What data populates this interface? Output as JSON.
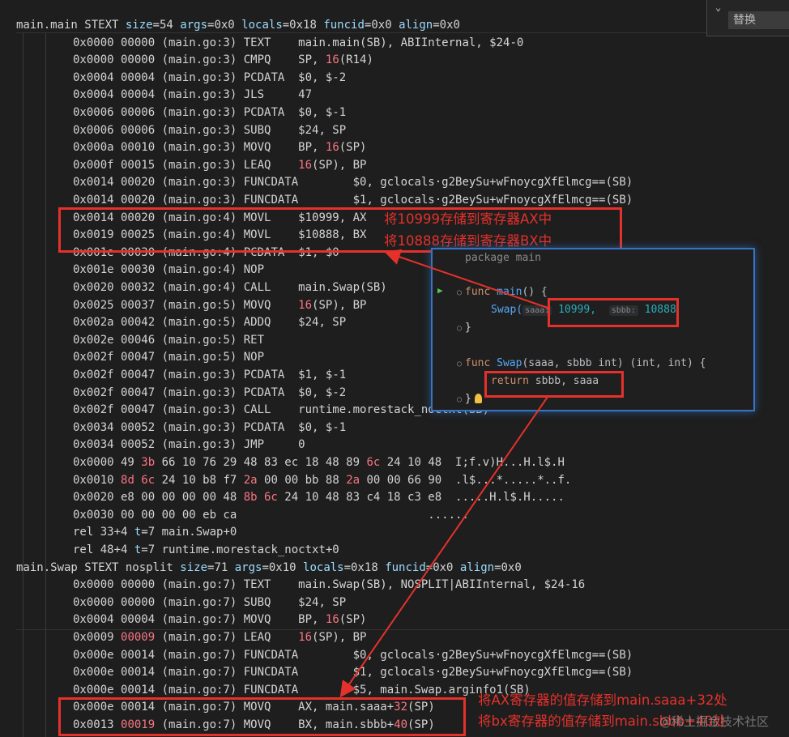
{
  "find": {
    "replace_placeholder": "替换",
    "toggle_icon": "chevron-down-icon"
  },
  "listing": [
    {
      "k": "sym",
      "t": [
        [
          "main.main STEXT ",
          "w"
        ],
        [
          "size",
          "b"
        ],
        [
          "=54 ",
          "w"
        ],
        [
          "args",
          "b"
        ],
        [
          "=0x0 ",
          "w"
        ],
        [
          "locals",
          "b"
        ],
        [
          "=0x18 ",
          "w"
        ],
        [
          "funcid",
          "b"
        ],
        [
          "=0x0 ",
          "w"
        ],
        [
          "align",
          "b"
        ],
        [
          "=0x0",
          "w"
        ]
      ]
    },
    {
      "k": "ins",
      "t": [
        [
          "0x0000 00000 ",
          "w"
        ],
        [
          "(main.go:3) ",
          "w"
        ],
        [
          "TEXT    main.main(SB), ABIInternal, $24-0",
          "w"
        ]
      ]
    },
    {
      "k": "ins",
      "t": [
        [
          "0x0000 00000 ",
          "w"
        ],
        [
          "(main.go:3) ",
          "w"
        ],
        [
          "CMPQ    SP, ",
          "w"
        ],
        [
          "16",
          "n"
        ],
        [
          "(R14)",
          "w"
        ]
      ]
    },
    {
      "k": "ins",
      "t": [
        [
          "0x0004 00004 ",
          "w"
        ],
        [
          "(main.go:3) ",
          "w"
        ],
        [
          "PCDATA  $0, $-2",
          "w"
        ]
      ]
    },
    {
      "k": "ins",
      "t": [
        [
          "0x0004 00004 ",
          "w"
        ],
        [
          "(main.go:3) ",
          "w"
        ],
        [
          "JLS     47",
          "w"
        ]
      ]
    },
    {
      "k": "ins",
      "t": [
        [
          "0x0006 00006 ",
          "w"
        ],
        [
          "(main.go:3) ",
          "w"
        ],
        [
          "PCDATA  $0, $-1",
          "w"
        ]
      ]
    },
    {
      "k": "ins",
      "t": [
        [
          "0x0006 00006 ",
          "w"
        ],
        [
          "(main.go:3) ",
          "w"
        ],
        [
          "SUBQ    $24, SP",
          "w"
        ]
      ]
    },
    {
      "k": "ins",
      "t": [
        [
          "0x000a 00010 ",
          "w"
        ],
        [
          "(main.go:3) ",
          "w"
        ],
        [
          "MOVQ    BP, ",
          "w"
        ],
        [
          "16",
          "n"
        ],
        [
          "(SP)",
          "w"
        ]
      ]
    },
    {
      "k": "ins",
      "t": [
        [
          "0x000f 00015 ",
          "w"
        ],
        [
          "(main.go:3) ",
          "w"
        ],
        [
          "LEAQ    ",
          "w"
        ],
        [
          "16",
          "n"
        ],
        [
          "(SP), BP",
          "w"
        ]
      ]
    },
    {
      "k": "ins",
      "t": [
        [
          "0x0014 00020 ",
          "w"
        ],
        [
          "(main.go:3) ",
          "w"
        ],
        [
          "FUNCDATA        $0, gclocals·g2BeySu+wFnoycgXfElmcg==(SB)",
          "w"
        ]
      ]
    },
    {
      "k": "ins",
      "t": [
        [
          "0x0014 00020 ",
          "w"
        ],
        [
          "(main.go:3) ",
          "w"
        ],
        [
          "FUNCDATA        $1, gclocals·g2BeySu+wFnoycgXfElmcg==(SB)",
          "w"
        ]
      ]
    },
    {
      "k": "ins",
      "t": [
        [
          "0x0014 00020 ",
          "w"
        ],
        [
          "(main.go:4) ",
          "w"
        ],
        [
          "MOVL    $10999, AX",
          "w"
        ]
      ]
    },
    {
      "k": "ins",
      "t": [
        [
          "0x0019 00025 ",
          "w"
        ],
        [
          "(main.go:4) ",
          "w"
        ],
        [
          "MOVL    $10888, BX",
          "w"
        ]
      ]
    },
    {
      "k": "ins",
      "t": [
        [
          "0x001e 00030 ",
          "w"
        ],
        [
          "(main.go:4) ",
          "w"
        ],
        [
          "PCDATA  $1, $0",
          "w"
        ]
      ]
    },
    {
      "k": "ins",
      "t": [
        [
          "0x001e 00030 ",
          "w"
        ],
        [
          "(main.go:4) ",
          "w"
        ],
        [
          "NOP",
          "w"
        ]
      ]
    },
    {
      "k": "ins",
      "t": [
        [
          "0x0020 00032 ",
          "w"
        ],
        [
          "(main.go:4) ",
          "w"
        ],
        [
          "CALL    main.Swap(SB)",
          "w"
        ]
      ]
    },
    {
      "k": "ins",
      "t": [
        [
          "0x0025 00037 ",
          "w"
        ],
        [
          "(main.go:5) ",
          "w"
        ],
        [
          "MOVQ    ",
          "w"
        ],
        [
          "16",
          "n"
        ],
        [
          "(SP), BP",
          "w"
        ]
      ]
    },
    {
      "k": "ins",
      "t": [
        [
          "0x002a 00042 ",
          "w"
        ],
        [
          "(main.go:5) ",
          "w"
        ],
        [
          "ADDQ    $24, SP",
          "w"
        ]
      ]
    },
    {
      "k": "ins",
      "t": [
        [
          "0x002e 00046 ",
          "w"
        ],
        [
          "(main.go:5) ",
          "w"
        ],
        [
          "RET",
          "w"
        ]
      ]
    },
    {
      "k": "ins",
      "t": [
        [
          "0x002f 00047 ",
          "w"
        ],
        [
          "(main.go:5) ",
          "w"
        ],
        [
          "NOP",
          "w"
        ]
      ]
    },
    {
      "k": "ins",
      "t": [
        [
          "0x002f 00047 ",
          "w"
        ],
        [
          "(main.go:3) ",
          "w"
        ],
        [
          "PCDATA  $1, $-1",
          "w"
        ]
      ]
    },
    {
      "k": "ins",
      "t": [
        [
          "0x002f 00047 ",
          "w"
        ],
        [
          "(main.go:3) ",
          "w"
        ],
        [
          "PCDATA  $0, $-2",
          "w"
        ]
      ]
    },
    {
      "k": "ins",
      "t": [
        [
          "0x002f 00047 ",
          "w"
        ],
        [
          "(main.go:3) ",
          "w"
        ],
        [
          "CALL    runtime.morestack_noctxt(SB)",
          "w"
        ]
      ]
    },
    {
      "k": "ins",
      "t": [
        [
          "0x0034 00052 ",
          "w"
        ],
        [
          "(main.go:3) ",
          "w"
        ],
        [
          "PCDATA  $0, $-1",
          "w"
        ]
      ]
    },
    {
      "k": "ins",
      "t": [
        [
          "0x0034 00052 ",
          "w"
        ],
        [
          "(main.go:3) ",
          "w"
        ],
        [
          "JMP     0",
          "w"
        ]
      ]
    },
    {
      "k": "ins",
      "t": [
        [
          "0x0000 49 ",
          "w"
        ],
        [
          "3b",
          "n"
        ],
        [
          " 66 10 76 29 48 83 ec 18 48 89 ",
          "w"
        ],
        [
          "6c",
          "n"
        ],
        [
          " 24 10 48  I;f.v)H...H.l$.H",
          "w"
        ]
      ]
    },
    {
      "k": "ins",
      "t": [
        [
          "0x0010 ",
          "w"
        ],
        [
          "8d 6c",
          "n"
        ],
        [
          " 24 10 b8 f7 ",
          "w"
        ],
        [
          "2a",
          "n"
        ],
        [
          " 00 00 bb 88 ",
          "w"
        ],
        [
          "2a",
          "n"
        ],
        [
          " 00 00 66 90  .l$...*.....*..f.",
          "w"
        ]
      ]
    },
    {
      "k": "ins",
      "t": [
        [
          "0x0020 e8 00 00 00 00 48 ",
          "w"
        ],
        [
          "8b 6c",
          "n"
        ],
        [
          " 24 10 48 83 c4 18 c3 e8  .....H.l$.H.....",
          "w"
        ]
      ]
    },
    {
      "k": "ins",
      "t": [
        [
          "0x0030 00 00 00 00 eb ca                            ......",
          "w"
        ]
      ]
    },
    {
      "k": "ins",
      "t": [
        [
          "rel 33+4 ",
          "w"
        ],
        [
          "t",
          "b"
        ],
        [
          "=7 main.Swap+0",
          "w"
        ]
      ]
    },
    {
      "k": "ins",
      "t": [
        [
          "rel 48+4 ",
          "w"
        ],
        [
          "t",
          "b"
        ],
        [
          "=7 runtime.morestack_noctxt+0",
          "w"
        ]
      ]
    },
    {
      "k": "sym",
      "t": [
        [
          "main.Swap STEXT nosplit ",
          "w"
        ],
        [
          "size",
          "b"
        ],
        [
          "=71 ",
          "w"
        ],
        [
          "args",
          "b"
        ],
        [
          "=0x10 ",
          "w"
        ],
        [
          "locals",
          "b"
        ],
        [
          "=0x18 ",
          "w"
        ],
        [
          "funcid",
          "b"
        ],
        [
          "=0x0 ",
          "w"
        ],
        [
          "align",
          "b"
        ],
        [
          "=0x0",
          "w"
        ]
      ]
    },
    {
      "k": "ins",
      "t": [
        [
          "0x0000 00000 ",
          "w"
        ],
        [
          "(main.go:7) ",
          "w"
        ],
        [
          "TEXT    main.Swap(SB), NOSPLIT|ABIInternal, $24-16",
          "w"
        ]
      ]
    },
    {
      "k": "ins",
      "t": [
        [
          "0x0000 00000 ",
          "w"
        ],
        [
          "(main.go:7) ",
          "w"
        ],
        [
          "SUBQ    $24, SP",
          "w"
        ]
      ]
    },
    {
      "k": "ins",
      "t": [
        [
          "0x0004 00004 ",
          "w"
        ],
        [
          "(main.go:7) ",
          "w"
        ],
        [
          "MOVQ    BP, ",
          "w"
        ],
        [
          "16",
          "n"
        ],
        [
          "(SP)",
          "w"
        ]
      ]
    },
    {
      "k": "ins",
      "t": [
        [
          "0x0009 ",
          "w"
        ],
        [
          "00009",
          "n"
        ],
        [
          " (main.go:7) ",
          "w"
        ],
        [
          "LEAQ    ",
          "w"
        ],
        [
          "16",
          "n"
        ],
        [
          "(SP), BP",
          "w"
        ]
      ]
    },
    {
      "k": "ins",
      "t": [
        [
          "0x000e 00014 ",
          "w"
        ],
        [
          "(main.go:7) ",
          "w"
        ],
        [
          "FUNCDATA        $0, gclocals·g2BeySu+wFnoycgXfElmcg==(SB)",
          "w"
        ]
      ]
    },
    {
      "k": "ins",
      "t": [
        [
          "0x000e 00014 ",
          "w"
        ],
        [
          "(main.go:7) ",
          "w"
        ],
        [
          "FUNCDATA        $1, gclocals·g2BeySu+wFnoycgXfElmcg==(SB)",
          "w"
        ]
      ]
    },
    {
      "k": "ins",
      "t": [
        [
          "0x000e 00014 ",
          "w"
        ],
        [
          "(main.go:7) ",
          "w"
        ],
        [
          "FUNCDATA        $5, main.Swap.arginfo1(SB)",
          "w"
        ]
      ]
    },
    {
      "k": "ins",
      "t": [
        [
          "0x000e 00014 ",
          "w"
        ],
        [
          "(main.go:7) ",
          "w"
        ],
        [
          "MOVQ    AX, main.saaa+",
          "w"
        ],
        [
          "32",
          "n"
        ],
        [
          "(SP)",
          "w"
        ]
      ]
    },
    {
      "k": "ins",
      "t": [
        [
          "0x0013 ",
          "w"
        ],
        [
          "00019",
          "n"
        ],
        [
          " (main.go:7) ",
          "w"
        ],
        [
          "MOVQ    BX, main.sbbb+",
          "w"
        ],
        [
          "40",
          "n"
        ],
        [
          "(SP)",
          "w"
        ]
      ]
    }
  ],
  "annotations": {
    "ax_note": "将10999存储到寄存器AX中",
    "bx_note": "将10888存储到寄存器BX中",
    "saaa_note": "将AX寄存器的值存储到main.saaa+32处",
    "sbbb_note": "将bx寄存器的值存储到main.sbbb+40处"
  },
  "popup": {
    "line_package": "package main",
    "kw_func": "func",
    "fn_main": "main",
    "main_tail": "() {",
    "call_fn": "Swap(",
    "hint_saaa": "saaa:",
    "arg1": "10999,",
    "hint_sbbb": "sbbb:",
    "arg2": "10888",
    "close1": "}",
    "fn_swap": "Swap",
    "swap_sig": "(saaa, sbbb int) (int, int) {",
    "kw_return": "return",
    "return_vals": " sbbb, saaa",
    "close2": "}"
  },
  "watermark": "@稀土掘金技术社区",
  "colors": {
    "accent": "#e5312b",
    "popup_border": "#3574c4",
    "background": "#1e1e1e"
  }
}
